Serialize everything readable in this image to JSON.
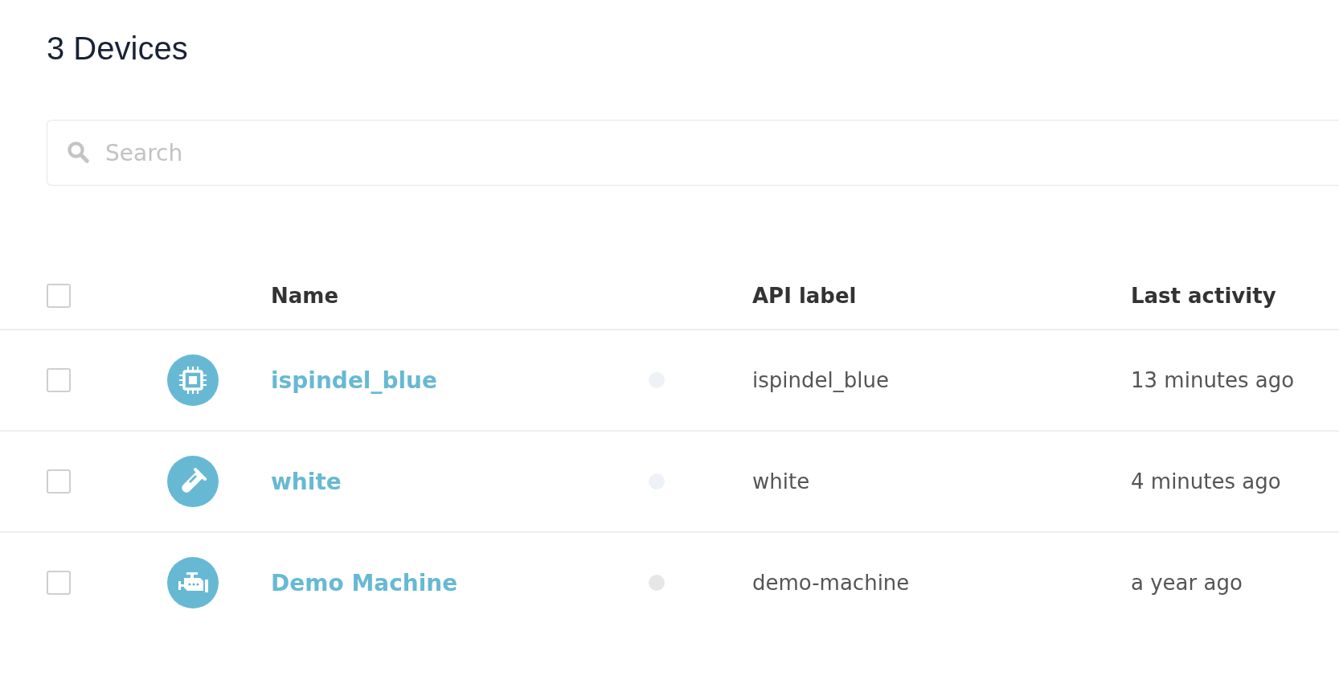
{
  "title": "3 Devices",
  "search": {
    "placeholder": "Search"
  },
  "table": {
    "header_checkbox": {
      "checked": false
    },
    "columns": [
      "Name",
      "API label",
      "Last activity"
    ],
    "rows": [
      {
        "checked": false,
        "kind": "chip",
        "name": "ispindel_blue",
        "color": "#eef1f5",
        "api_label": "ispindel_blue",
        "last_activity": "13 minutes ago"
      },
      {
        "checked": false,
        "kind": "test-tube",
        "name": "white",
        "color": "#eef1f5",
        "api_label": "white",
        "last_activity": "4 minutes ago"
      },
      {
        "checked": false,
        "kind": "engine",
        "name": "Demo Machine",
        "color": "#e6e6e6",
        "api_label": "demo-machine",
        "last_activity": "a year ago"
      }
    ]
  }
}
